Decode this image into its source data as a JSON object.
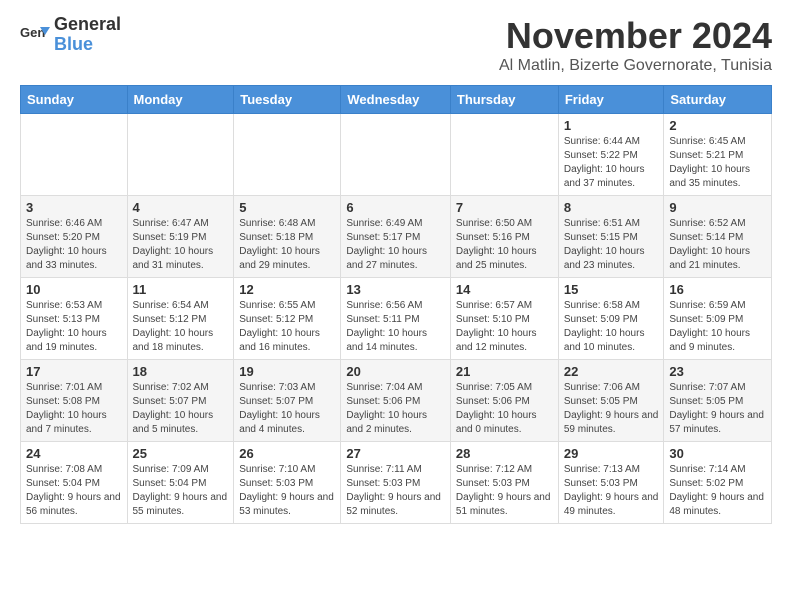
{
  "header": {
    "logo_line1": "General",
    "logo_line2": "Blue",
    "month_title": "November 2024",
    "location": "Al Matlin, Bizerte Governorate, Tunisia"
  },
  "weekdays": [
    "Sunday",
    "Monday",
    "Tuesday",
    "Wednesday",
    "Thursday",
    "Friday",
    "Saturday"
  ],
  "weeks": [
    [
      {
        "day": "",
        "info": ""
      },
      {
        "day": "",
        "info": ""
      },
      {
        "day": "",
        "info": ""
      },
      {
        "day": "",
        "info": ""
      },
      {
        "day": "",
        "info": ""
      },
      {
        "day": "1",
        "info": "Sunrise: 6:44 AM\nSunset: 5:22 PM\nDaylight: 10 hours and 37 minutes."
      },
      {
        "day": "2",
        "info": "Sunrise: 6:45 AM\nSunset: 5:21 PM\nDaylight: 10 hours and 35 minutes."
      }
    ],
    [
      {
        "day": "3",
        "info": "Sunrise: 6:46 AM\nSunset: 5:20 PM\nDaylight: 10 hours and 33 minutes."
      },
      {
        "day": "4",
        "info": "Sunrise: 6:47 AM\nSunset: 5:19 PM\nDaylight: 10 hours and 31 minutes."
      },
      {
        "day": "5",
        "info": "Sunrise: 6:48 AM\nSunset: 5:18 PM\nDaylight: 10 hours and 29 minutes."
      },
      {
        "day": "6",
        "info": "Sunrise: 6:49 AM\nSunset: 5:17 PM\nDaylight: 10 hours and 27 minutes."
      },
      {
        "day": "7",
        "info": "Sunrise: 6:50 AM\nSunset: 5:16 PM\nDaylight: 10 hours and 25 minutes."
      },
      {
        "day": "8",
        "info": "Sunrise: 6:51 AM\nSunset: 5:15 PM\nDaylight: 10 hours and 23 minutes."
      },
      {
        "day": "9",
        "info": "Sunrise: 6:52 AM\nSunset: 5:14 PM\nDaylight: 10 hours and 21 minutes."
      }
    ],
    [
      {
        "day": "10",
        "info": "Sunrise: 6:53 AM\nSunset: 5:13 PM\nDaylight: 10 hours and 19 minutes."
      },
      {
        "day": "11",
        "info": "Sunrise: 6:54 AM\nSunset: 5:12 PM\nDaylight: 10 hours and 18 minutes."
      },
      {
        "day": "12",
        "info": "Sunrise: 6:55 AM\nSunset: 5:12 PM\nDaylight: 10 hours and 16 minutes."
      },
      {
        "day": "13",
        "info": "Sunrise: 6:56 AM\nSunset: 5:11 PM\nDaylight: 10 hours and 14 minutes."
      },
      {
        "day": "14",
        "info": "Sunrise: 6:57 AM\nSunset: 5:10 PM\nDaylight: 10 hours and 12 minutes."
      },
      {
        "day": "15",
        "info": "Sunrise: 6:58 AM\nSunset: 5:09 PM\nDaylight: 10 hours and 10 minutes."
      },
      {
        "day": "16",
        "info": "Sunrise: 6:59 AM\nSunset: 5:09 PM\nDaylight: 10 hours and 9 minutes."
      }
    ],
    [
      {
        "day": "17",
        "info": "Sunrise: 7:01 AM\nSunset: 5:08 PM\nDaylight: 10 hours and 7 minutes."
      },
      {
        "day": "18",
        "info": "Sunrise: 7:02 AM\nSunset: 5:07 PM\nDaylight: 10 hours and 5 minutes."
      },
      {
        "day": "19",
        "info": "Sunrise: 7:03 AM\nSunset: 5:07 PM\nDaylight: 10 hours and 4 minutes."
      },
      {
        "day": "20",
        "info": "Sunrise: 7:04 AM\nSunset: 5:06 PM\nDaylight: 10 hours and 2 minutes."
      },
      {
        "day": "21",
        "info": "Sunrise: 7:05 AM\nSunset: 5:06 PM\nDaylight: 10 hours and 0 minutes."
      },
      {
        "day": "22",
        "info": "Sunrise: 7:06 AM\nSunset: 5:05 PM\nDaylight: 9 hours and 59 minutes."
      },
      {
        "day": "23",
        "info": "Sunrise: 7:07 AM\nSunset: 5:05 PM\nDaylight: 9 hours and 57 minutes."
      }
    ],
    [
      {
        "day": "24",
        "info": "Sunrise: 7:08 AM\nSunset: 5:04 PM\nDaylight: 9 hours and 56 minutes."
      },
      {
        "day": "25",
        "info": "Sunrise: 7:09 AM\nSunset: 5:04 PM\nDaylight: 9 hours and 55 minutes."
      },
      {
        "day": "26",
        "info": "Sunrise: 7:10 AM\nSunset: 5:03 PM\nDaylight: 9 hours and 53 minutes."
      },
      {
        "day": "27",
        "info": "Sunrise: 7:11 AM\nSunset: 5:03 PM\nDaylight: 9 hours and 52 minutes."
      },
      {
        "day": "28",
        "info": "Sunrise: 7:12 AM\nSunset: 5:03 PM\nDaylight: 9 hours and 51 minutes."
      },
      {
        "day": "29",
        "info": "Sunrise: 7:13 AM\nSunset: 5:03 PM\nDaylight: 9 hours and 49 minutes."
      },
      {
        "day": "30",
        "info": "Sunrise: 7:14 AM\nSunset: 5:02 PM\nDaylight: 9 hours and 48 minutes."
      }
    ]
  ]
}
